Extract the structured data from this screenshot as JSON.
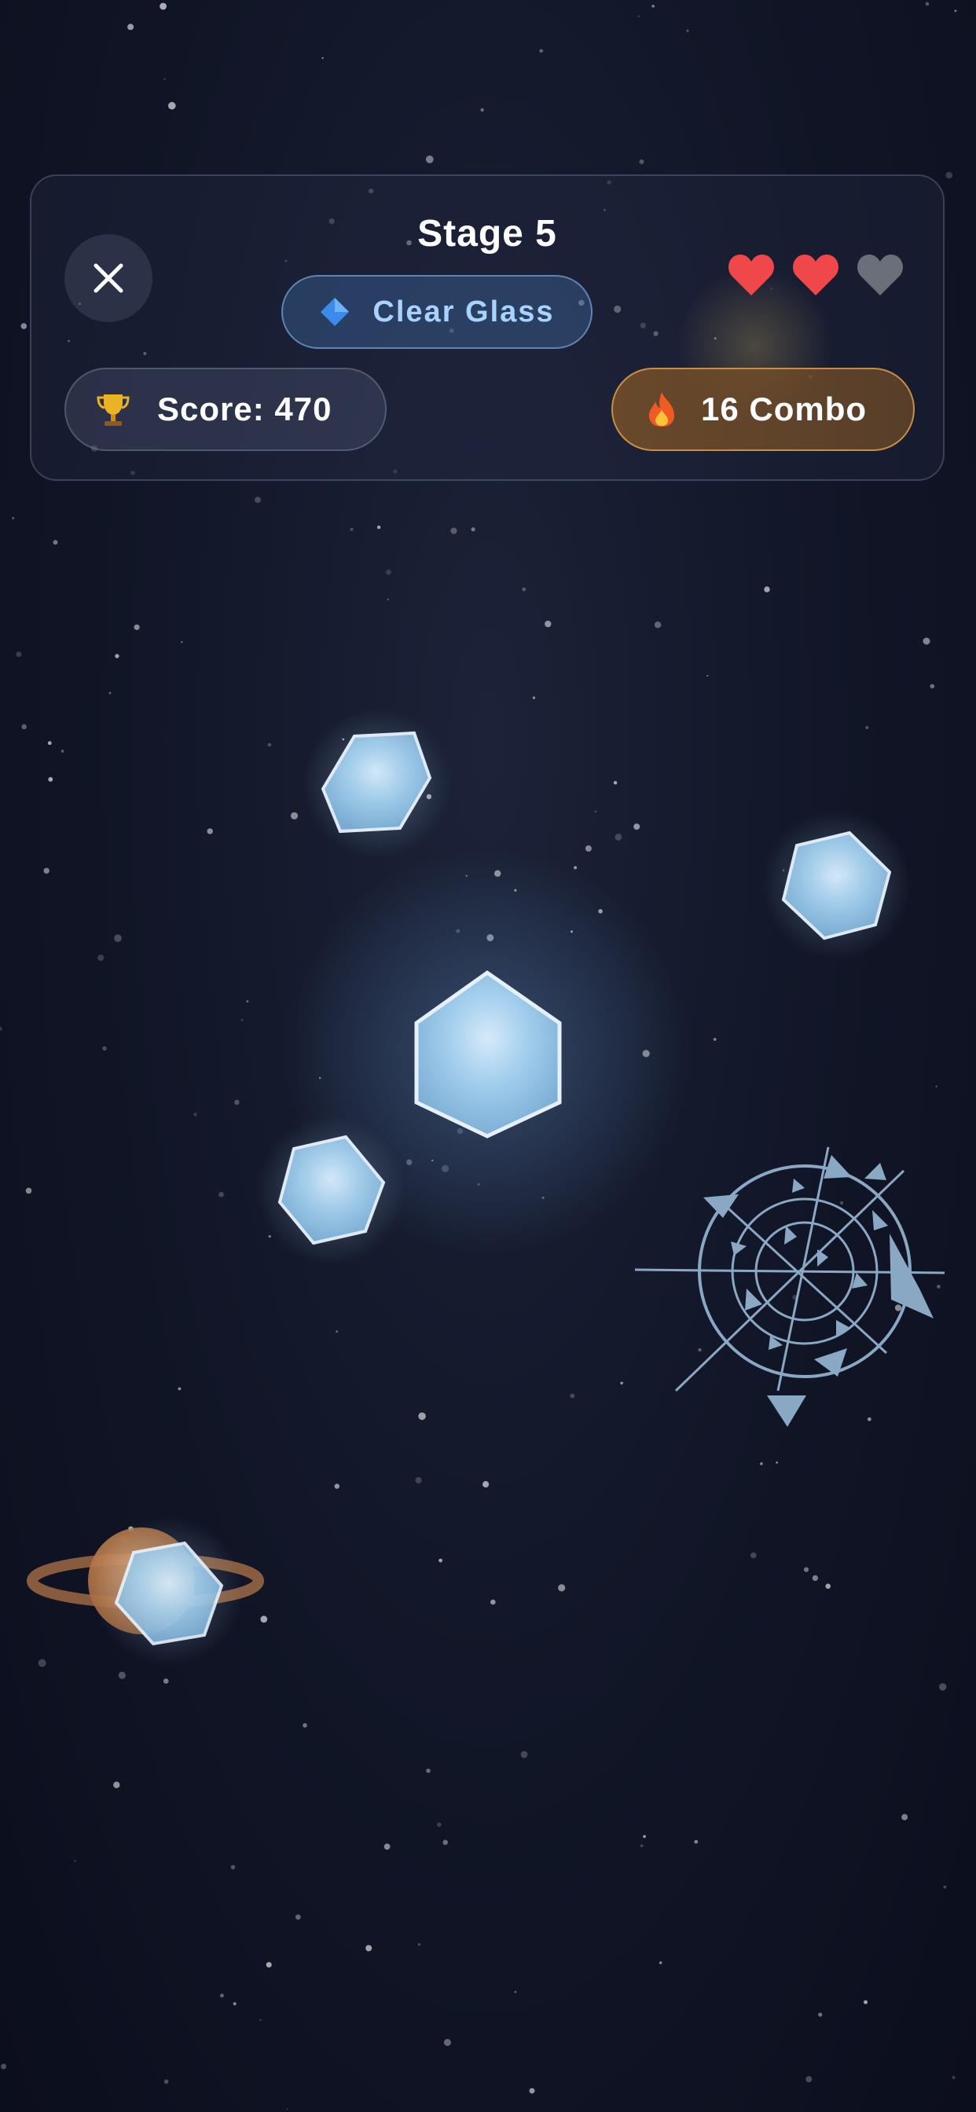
{
  "hud": {
    "stage_title": "Stage 5",
    "mode_label": "Clear Glass",
    "mode_icon": "blue-diamond-icon",
    "score_label": "Score: 470",
    "score_icon": "trophy-icon",
    "combo_label": "16 Combo",
    "combo_icon": "fire-icon",
    "lives_total": 3,
    "lives_remaining": 2,
    "close_icon": "close-icon"
  },
  "colors": {
    "background": "#121729",
    "heart_full": "#f0474a",
    "heart_empty": "#6b6f7a",
    "glass": "#a8d4f2",
    "mode_text": "#a9d3ff",
    "combo_border": "#e6aa50",
    "planet": "#c9834f"
  },
  "game": {
    "objects": [
      "glass-hexagon",
      "glass-hexagon",
      "glass-hexagon",
      "glass-hexagon",
      "glass-hexagon",
      "glass-hexagon",
      "shatter-burst",
      "ringed-planet"
    ]
  }
}
